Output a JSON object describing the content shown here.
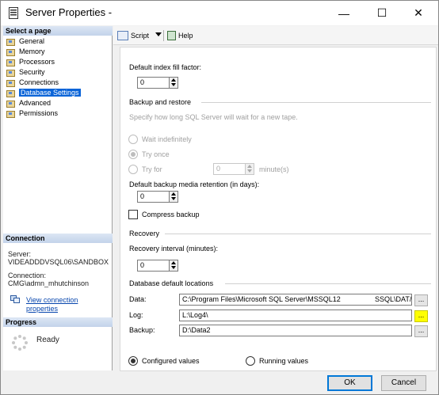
{
  "window": {
    "title": "Server Properties -",
    "minimize_glyph": "—",
    "maximize_glyph": "☐",
    "close_glyph": "✕"
  },
  "left_panel": {
    "select_page_header": "Select a page",
    "pages": [
      {
        "label": "General",
        "selected": false
      },
      {
        "label": "Memory",
        "selected": false
      },
      {
        "label": "Processors",
        "selected": false
      },
      {
        "label": "Security",
        "selected": false
      },
      {
        "label": "Connections",
        "selected": false
      },
      {
        "label": "Database Settings",
        "selected": true
      },
      {
        "label": "Advanced",
        "selected": false
      },
      {
        "label": "Permissions",
        "selected": false
      }
    ],
    "connection_header": "Connection",
    "server_label": "Server:",
    "server_value": "VIDEADDDVSQL06\\SANDBOX",
    "connection_label": "Connection:",
    "connection_value": "CMG\\admn_mhutchinson",
    "view_connection_line1": "View connection",
    "view_connection_line2": "properties",
    "progress_header": "Progress",
    "progress_status": "Ready"
  },
  "toolbar": {
    "script_label": "Script",
    "help_label": "Help"
  },
  "settings": {
    "fill_factor_label": "Default index fill factor:",
    "fill_factor_value": "0",
    "backup_restore_group": "Backup and restore",
    "tape_hint": "Specify how long SQL Server will wait for a new tape.",
    "wait_indefinitely": "Wait indefinitely",
    "try_once": "Try once",
    "try_for": "Try for",
    "try_for_value": "0",
    "minutes_unit": "minute(s)",
    "retention_label": "Default backup media retention (in days):",
    "retention_value": "0",
    "compress_backup": "Compress backup",
    "recovery_group": "Recovery",
    "recovery_interval_label": "Recovery interval (minutes):",
    "recovery_interval_value": "0",
    "locations_group": "Database default locations",
    "data_label": "Data:",
    "data_path": "C:\\Program Files\\Microsoft SQL Server\\MSSQL12",
    "data_path_tail": "SSQL\\DAT/",
    "log_label": "Log:",
    "log_path": "L:\\Log4\\",
    "backup_label": "Backup:",
    "backup_path": "D:\\Data2",
    "browse_glyph": "..."
  },
  "view_mode": {
    "configured_values": "Configured values",
    "running_values": "Running values",
    "selected": "configured"
  },
  "footer": {
    "ok_label": "OK",
    "cancel_label": "Cancel"
  }
}
